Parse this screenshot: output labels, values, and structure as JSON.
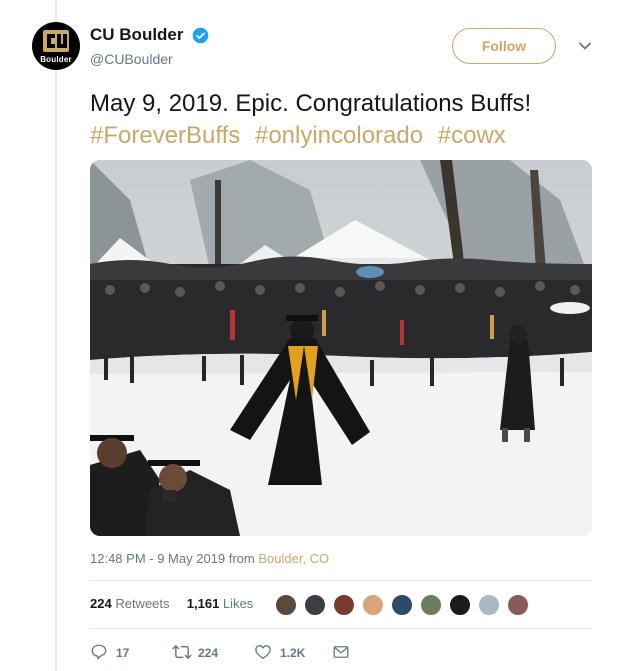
{
  "account": {
    "display_name": "CU Boulder",
    "handle": "@CUBoulder",
    "avatar_label": "Boulder",
    "verified": true
  },
  "follow_label": "Follow",
  "tweet": {
    "text": "May 9, 2019. Epic. Congratulations Buffs!",
    "hashtags": [
      "#ForeverBuffs",
      "#onlyincolorado",
      "#cowx"
    ]
  },
  "meta": {
    "time_date": "12:48 PM - 9 May 2019 from ",
    "location": "Boulder, CO"
  },
  "stats": {
    "retweets_count": "224",
    "retweets_label": "Retweets",
    "likes_count": "1,161",
    "likes_label": "Likes"
  },
  "likers": [
    {
      "color": "#5a4a3c"
    },
    {
      "color": "#3b3f45"
    },
    {
      "color": "#7a3b2e"
    },
    {
      "color": "#d9a47a"
    },
    {
      "color": "#2e4a6b"
    },
    {
      "color": "#6b7d5a"
    },
    {
      "color": "#1b1b1b"
    },
    {
      "color": "#aab8c2"
    },
    {
      "color": "#8a5a5a"
    }
  ],
  "actions": {
    "replies": "17",
    "retweets": "224",
    "likes": "1.2K"
  },
  "colors": {
    "accent": "#c9a86a",
    "text": "#14171a",
    "secondary": "#657786",
    "verified": "#1da1f2"
  },
  "icons": {
    "reply": "reply-icon",
    "retweet": "retweet-icon",
    "like": "heart-icon",
    "dm": "envelope-icon",
    "more": "chevron-down-icon",
    "verified": "verified-badge-icon"
  }
}
